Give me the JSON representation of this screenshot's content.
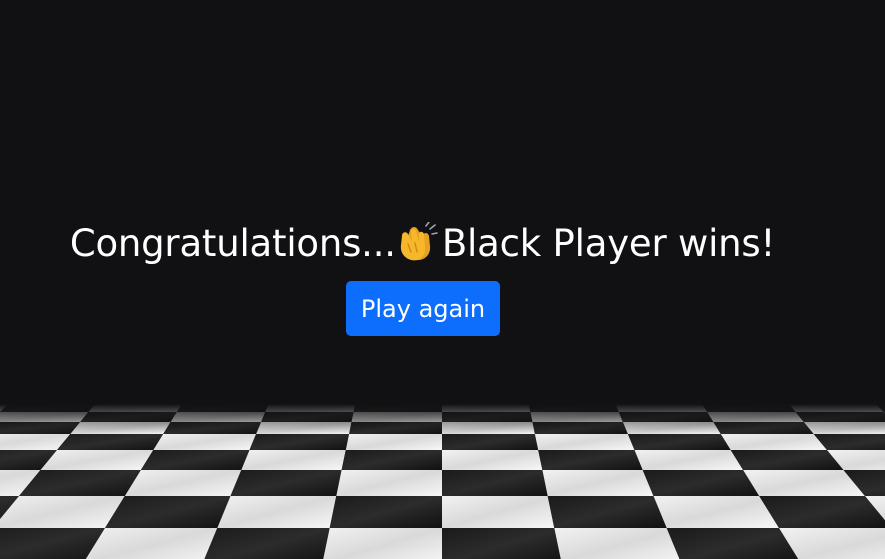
{
  "result": {
    "prefix": "Congratulations...",
    "emoji_icon": "clapping-hands-icon",
    "winner_text": "Black Player wins!"
  },
  "actions": {
    "play_again_label": "Play again"
  },
  "colors": {
    "background": "#111113",
    "button": "#0d6efd",
    "text": "#ffffff",
    "emoji": "#f6b72b"
  }
}
